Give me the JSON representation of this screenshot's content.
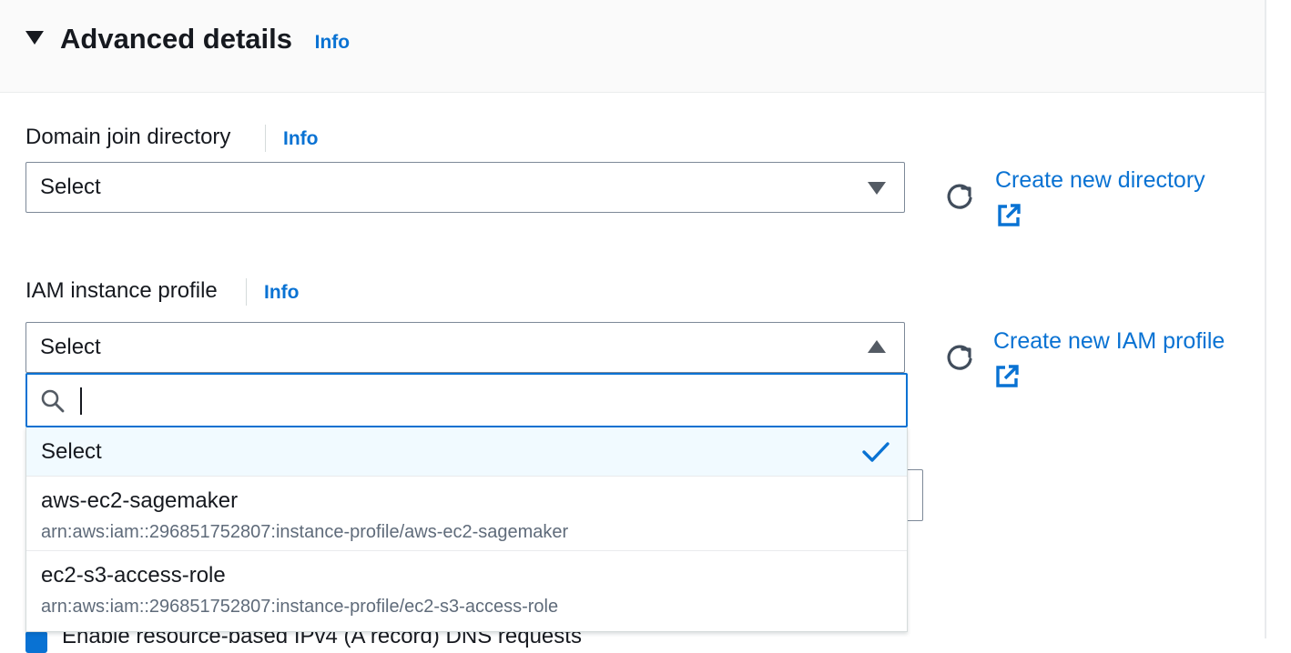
{
  "section": {
    "title": "Advanced details",
    "info_label": "Info",
    "expanded": true
  },
  "domain_join": {
    "label": "Domain join directory",
    "info_label": "Info",
    "selected_value": "Select",
    "refresh_icon": "refresh-icon",
    "create_link": "Create new directory",
    "external_icon": "external-link-icon"
  },
  "iam_profile": {
    "label": "IAM instance profile",
    "info_label": "Info",
    "selected_value": "Select",
    "refresh_icon": "refresh-icon",
    "create_link": "Create new IAM profile",
    "external_icon": "external-link-icon",
    "dropdown_open": true,
    "search": {
      "value": "",
      "placeholder": "",
      "icon": "search-icon"
    },
    "options": [
      {
        "title": "Select",
        "selected": true
      },
      {
        "title": "aws-ec2-sagemaker",
        "subtitle": "arn:aws:iam::296851752807:instance-profile/aws-ec2-sagemaker",
        "selected": false
      },
      {
        "title": "ec2-s3-access-role",
        "subtitle": "arn:aws:iam::296851752807:instance-profile/ec2-s3-access-role",
        "selected": false
      }
    ]
  },
  "partially_hidden": {
    "checkbox_label": "Enable resource-based IPv4 (A record) DNS requests",
    "checkbox_checked": true
  },
  "colors": {
    "link": "#0972d3",
    "text": "#16191f",
    "muted": "#5f6b7a",
    "header_bg": "#fafafa",
    "selected_option_bg": "#f1faff",
    "border": "#7d8998"
  }
}
